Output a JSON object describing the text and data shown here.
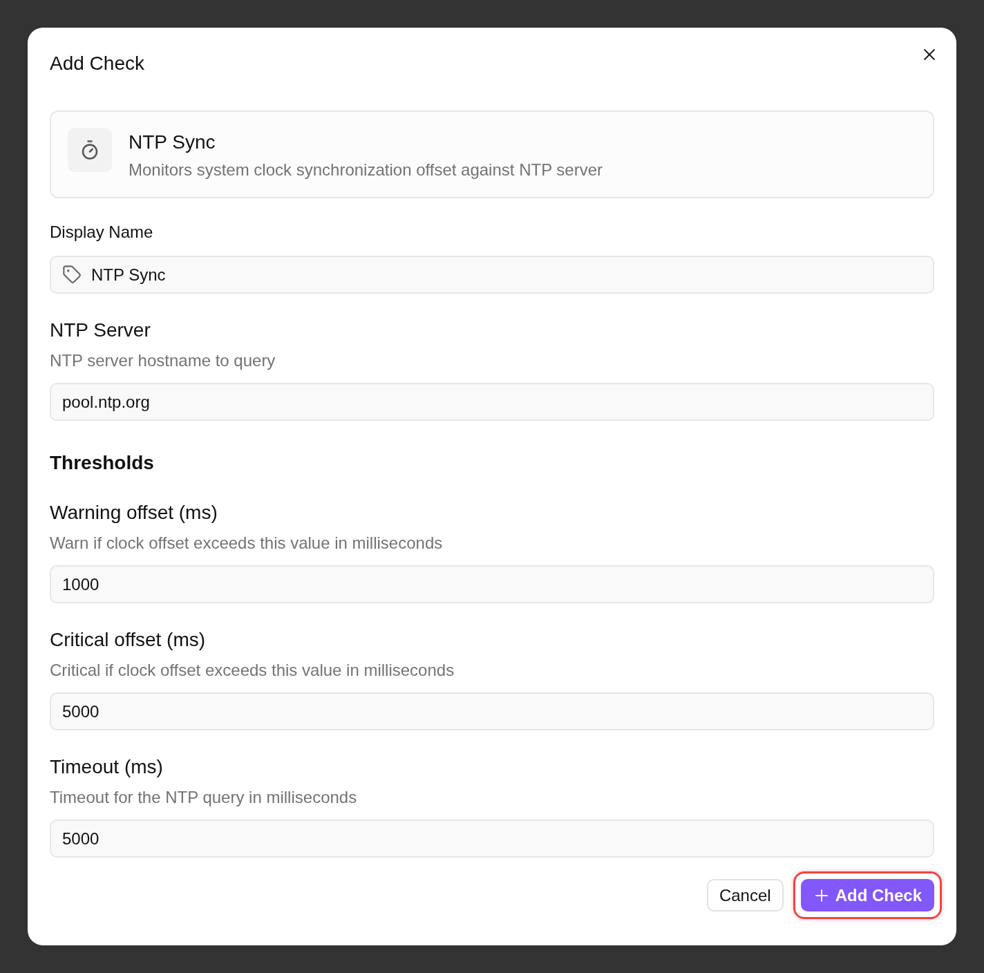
{
  "dialog": {
    "title": "Add Check"
  },
  "check_type": {
    "name": "NTP Sync",
    "description": "Monitors system clock synchronization offset against NTP server"
  },
  "display_name": {
    "label": "Display Name",
    "value": "NTP Sync"
  },
  "server": {
    "label": "NTP Server",
    "hint": "NTP server hostname to query",
    "value": "pool.ntp.org"
  },
  "thresholds": {
    "heading": "Thresholds",
    "fields": [
      {
        "label": "Warning offset (ms)",
        "hint": "Warn if clock offset exceeds this value in milliseconds",
        "value": "1000"
      },
      {
        "label": "Critical offset (ms)",
        "hint": "Critical if clock offset exceeds this value in milliseconds",
        "value": "5000"
      },
      {
        "label": "Timeout (ms)",
        "hint": "Timeout for the NTP query in milliseconds",
        "value": "5000"
      }
    ]
  },
  "buttons": [
    {
      "kind": "secondary",
      "label": "Cancel",
      "focused": false
    },
    {
      "kind": "primary",
      "label": "Add Check",
      "focused": true
    }
  ]
}
